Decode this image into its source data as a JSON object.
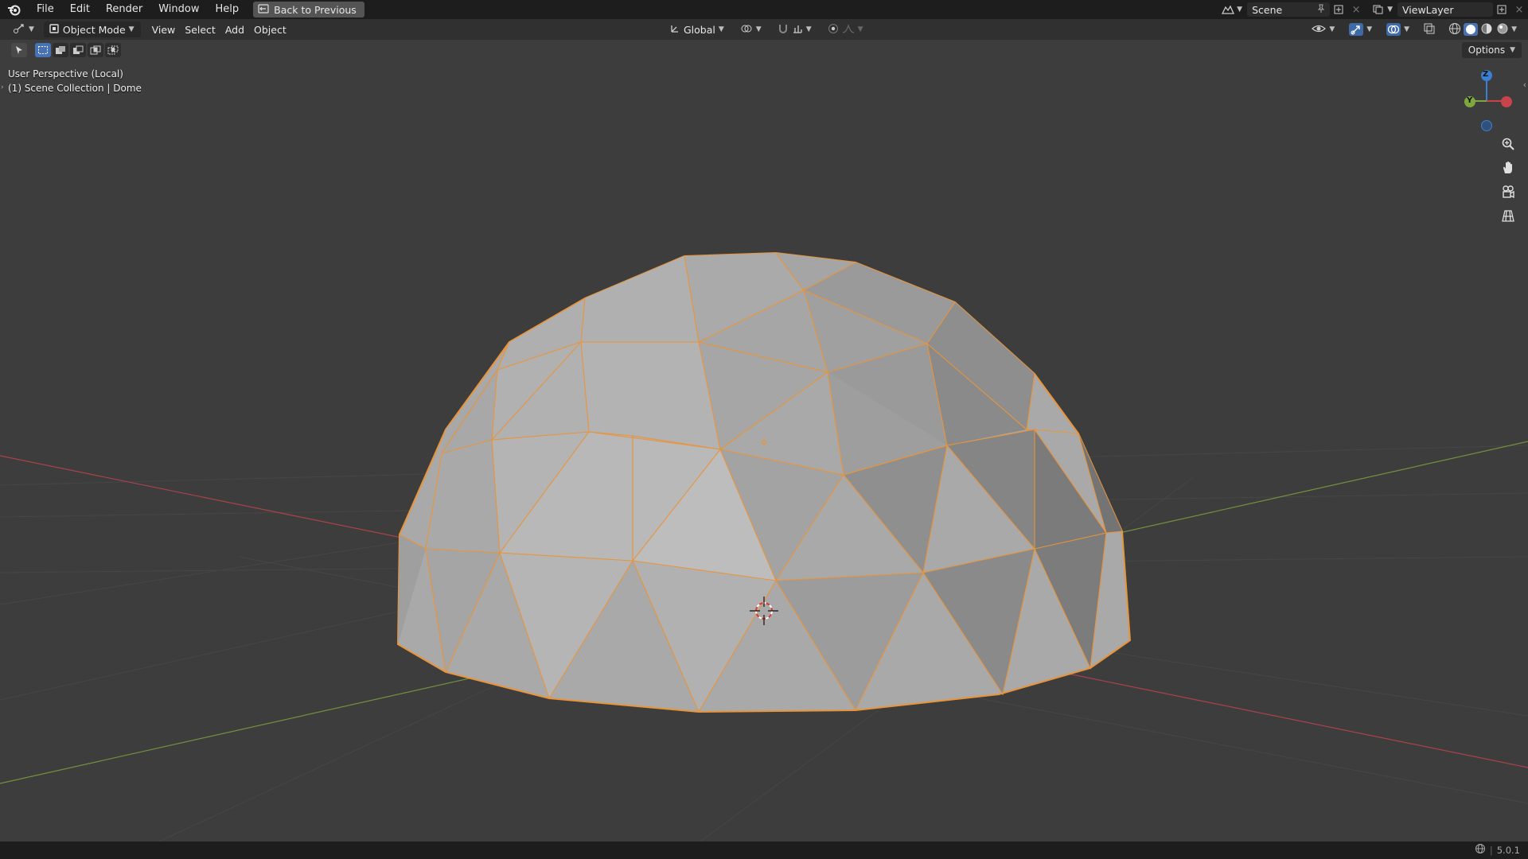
{
  "top_menu": {
    "items": [
      "File",
      "Edit",
      "Render",
      "Window",
      "Help"
    ],
    "back_button": "Back to Previous",
    "scene_name": "Scene",
    "view_layer": "ViewLayer"
  },
  "viewport_header": {
    "mode": "Object Mode",
    "menus": [
      "View",
      "Select",
      "Add",
      "Object"
    ],
    "transform_orientation": "Global",
    "options_label": "Options"
  },
  "viewport": {
    "view_name": "User Perspective (Local)",
    "collection_info": "(1) Scene Collection | Dome",
    "gizmo": {
      "z": "Z",
      "y": "Y"
    }
  },
  "status_bar": {
    "version": "5.0.1"
  },
  "colors": {
    "background": "#3d3d3d",
    "selection_outline": "#e8943a",
    "axis_x": "#c7444c",
    "axis_y": "#7ea83e",
    "axis_z": "#3b7fd4"
  },
  "icons": [
    "blender-logo-icon",
    "back-icon",
    "scene-icon",
    "pin-icon",
    "new-scene-icon",
    "close-icon",
    "viewlayer-icon",
    "editor-type-icon",
    "object-mode-icon",
    "orientation-icon",
    "pivot-icon",
    "snap-icon",
    "proportional-icon",
    "visibility-icon",
    "gizmo-icon",
    "overlay-icon",
    "xray-icon",
    "shading-wire-icon",
    "shading-solid-icon",
    "shading-material-icon",
    "shading-rendered-icon",
    "select-tool-icon",
    "zoom-icon",
    "hand-icon",
    "camera-icon",
    "grid-icon",
    "globe-icon"
  ]
}
